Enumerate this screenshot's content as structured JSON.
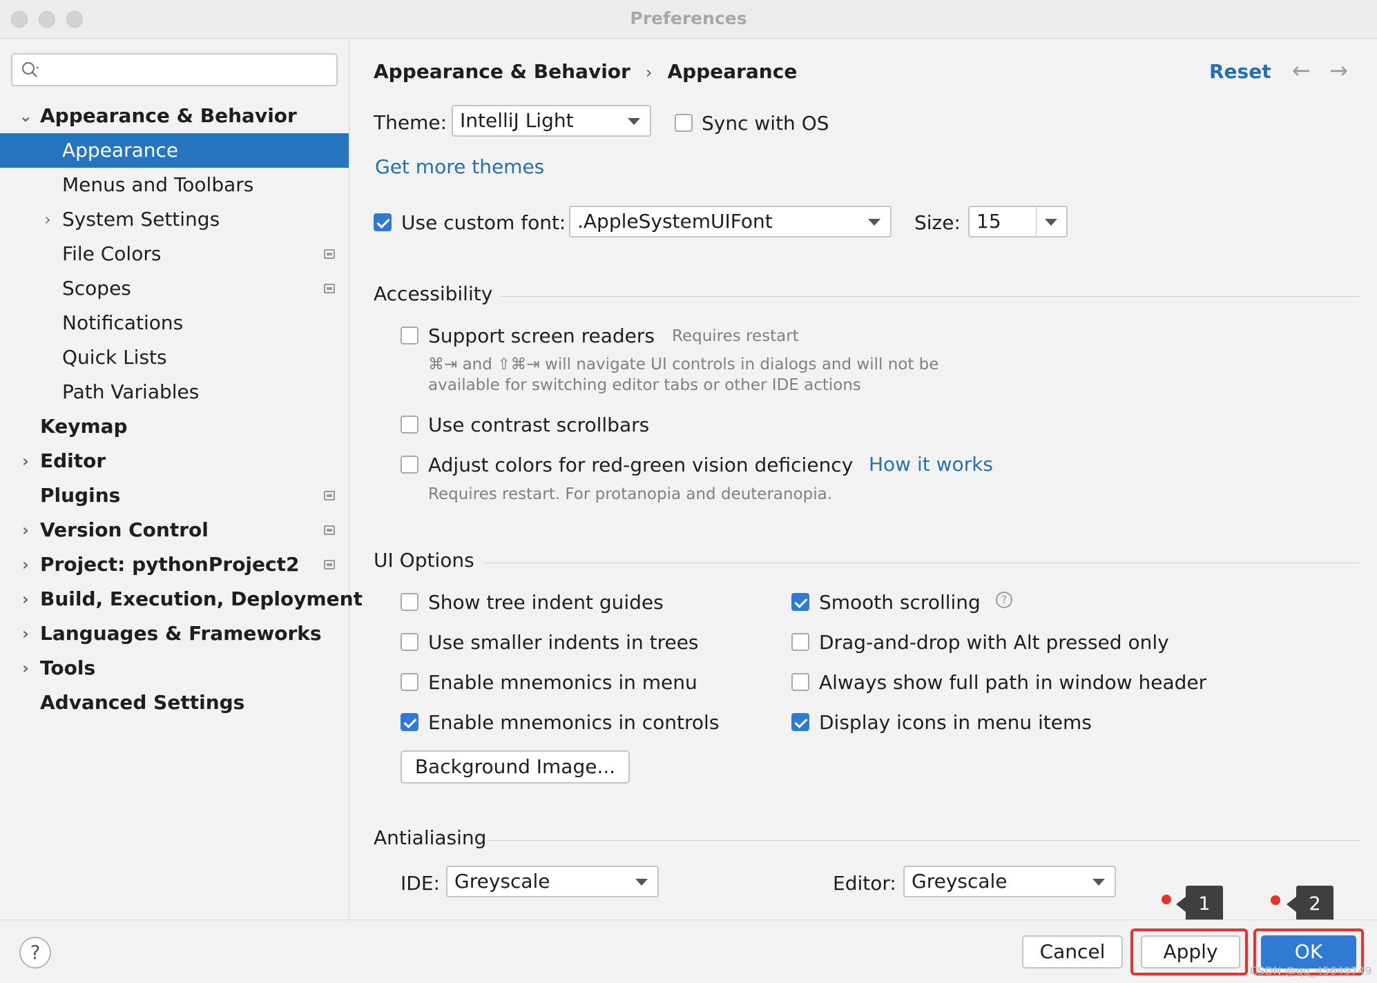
{
  "window": {
    "title": "Preferences"
  },
  "sidebar": {
    "search": {
      "value": "",
      "placeholder": ""
    },
    "items": [
      {
        "label": "Appearance & Behavior",
        "expanded": true
      },
      {
        "label": "Appearance",
        "selected": true
      },
      {
        "label": "Menus and Toolbars"
      },
      {
        "label": "System Settings"
      },
      {
        "label": "File Colors"
      },
      {
        "label": "Scopes"
      },
      {
        "label": "Notifications"
      },
      {
        "label": "Quick Lists"
      },
      {
        "label": "Path Variables"
      },
      {
        "label": "Keymap"
      },
      {
        "label": "Editor"
      },
      {
        "label": "Plugins"
      },
      {
        "label": "Version Control"
      },
      {
        "label": "Project: pythonProject2"
      },
      {
        "label": "Build, Execution, Deployment"
      },
      {
        "label": "Languages & Frameworks"
      },
      {
        "label": "Tools"
      },
      {
        "label": "Advanced Settings"
      }
    ]
  },
  "header": {
    "breadcrumb_parent": "Appearance & Behavior",
    "breadcrumb_sep": "›",
    "breadcrumb_current": "Appearance",
    "reset_label": "Reset",
    "back_arrow": "←",
    "forward_arrow": "→"
  },
  "theme": {
    "label": "Theme:",
    "value": "IntelliJ Light",
    "sync_label": "Sync with OS",
    "sync_checked": false,
    "get_more_link": "Get more themes"
  },
  "font": {
    "use_custom_label": "Use custom font:",
    "use_custom_checked": true,
    "font_value": ".AppleSystemUIFont",
    "size_label": "Size:",
    "size_value": "15"
  },
  "accessibility": {
    "title": "Accessibility",
    "screen_readers_label": "Support screen readers",
    "screen_readers_checked": false,
    "requires_restart": "Requires restart",
    "screen_readers_desc_1": "⌘⇥ and ⇧⌘⇥ will navigate UI controls in dialogs and will not be",
    "screen_readers_desc_2": "available for switching editor tabs or other IDE actions",
    "contrast_scrollbars_label": "Use contrast scrollbars",
    "contrast_scrollbars_checked": false,
    "red_green_label": "Adjust colors for red-green vision deficiency",
    "red_green_checked": false,
    "how_it_works_link": "How it works",
    "red_green_desc": "Requires restart. For protanopia and deuteranopia."
  },
  "ui_options": {
    "title": "UI Options",
    "left": [
      {
        "label": "Show tree indent guides",
        "checked": false
      },
      {
        "label": "Use smaller indents in trees",
        "checked": false
      },
      {
        "label": "Enable mnemonics in menu",
        "checked": false
      },
      {
        "label": "Enable mnemonics in controls",
        "checked": true
      }
    ],
    "right": [
      {
        "label": "Smooth scrolling",
        "checked": true
      },
      {
        "label": "Drag-and-drop with Alt pressed only",
        "checked": false
      },
      {
        "label": "Always show full path in window header",
        "checked": false
      },
      {
        "label": "Display icons in menu items",
        "checked": true
      }
    ],
    "help_glyph": "?",
    "background_image_button": "Background Image..."
  },
  "antialiasing": {
    "title": "Antialiasing",
    "ide_label": "IDE:",
    "ide_value": "Greyscale",
    "editor_label": "Editor:",
    "editor_value": "Greyscale"
  },
  "footer": {
    "help_glyph": "?",
    "cancel_label": "Cancel",
    "apply_label": "Apply",
    "ok_label": "OK",
    "callout_1": "1",
    "callout_2": "2",
    "watermark": "CSDN @qq_45649749"
  },
  "colors": {
    "accent": "#2f7ad2",
    "selection": "#2675bf",
    "link": "#2470b3",
    "annotation_red": "#e5352b"
  }
}
